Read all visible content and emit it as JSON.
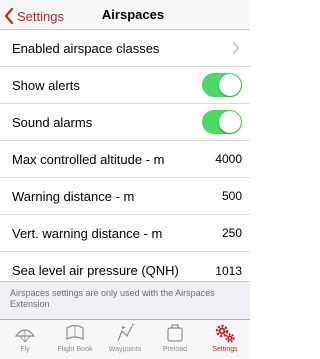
{
  "nav": {
    "back_label": "Settings",
    "title": "Airspaces"
  },
  "rows": [
    {
      "label": "Enabled airspace classes",
      "type": "disclosure"
    },
    {
      "label": "Show alerts",
      "type": "toggle",
      "on": true
    },
    {
      "label": "Sound alarms",
      "type": "toggle",
      "on": true
    },
    {
      "label": "Max controlled altitude - m",
      "value": "4000"
    },
    {
      "label": "Warning distance - m",
      "value": "500"
    },
    {
      "label": "Vert. warning distance - m",
      "value": "250"
    },
    {
      "label": "Sea level air pressure (QNH)",
      "value": "1013"
    }
  ],
  "footer_note": "Airspaces settings are only used with the Airspaces Extension",
  "tabs": [
    {
      "label": "Fly",
      "icon": "fly-icon",
      "active": false
    },
    {
      "label": "Flight Book",
      "icon": "flight-book-icon",
      "active": false
    },
    {
      "label": "Waypoints",
      "icon": "waypoints-icon",
      "active": false
    },
    {
      "label": "Preload",
      "icon": "preload-icon",
      "active": false
    },
    {
      "label": "Settings",
      "icon": "settings-icon",
      "active": true
    }
  ],
  "colors": {
    "accent": "#c4262e",
    "toggle_on": "#4cd964",
    "inactive_tab": "#8e8e93",
    "footer_background": "#efeff4"
  }
}
